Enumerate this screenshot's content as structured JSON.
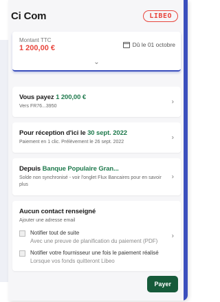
{
  "header": {
    "title": "Ci Com",
    "logo_text": "LIBEO"
  },
  "amount": {
    "label": "Montant TTC",
    "value": "1 200,00 €",
    "due": "Dû le 01 octobre",
    "expand_icon": "chevron-down-icon"
  },
  "rows": [
    {
      "title_prefix": "Vous payez ",
      "title_highlight": "1 200,00 €",
      "title_suffix": "",
      "subtitle": "Vers FR76...3950"
    },
    {
      "title_prefix": "Pour réception d'ici le ",
      "title_highlight": "30 sept. 2022",
      "title_suffix": "",
      "subtitle": "Paiement en 1 clic. Prélèvement le 26 sept. 2022"
    },
    {
      "title_prefix": "Depuis ",
      "title_highlight": "Banque Populaire Gran...",
      "title_suffix": "",
      "subtitle": "Solde non synchronisé - voir l'onglet Flux Bancaires pour en savoir plus"
    }
  ],
  "contact": {
    "title": "Aucun contact renseigné",
    "subtitle": "Ajouter une adresse email",
    "options": [
      {
        "label": "Notifier tout de suite",
        "sub": "Avec une preuve de planification du paiement (PDF)"
      },
      {
        "label": "Notifier votre fournisseur une fois le paiement réalisé",
        "sub": "Lorsque vos fonds quitteront Libeo"
      }
    ]
  },
  "actions": {
    "pay_label": "Payer"
  },
  "colors": {
    "accent": "#3b4fbd",
    "brand_red": "#e8453c",
    "highlight_green": "#1f7a4d",
    "button_green": "#165a3a"
  }
}
